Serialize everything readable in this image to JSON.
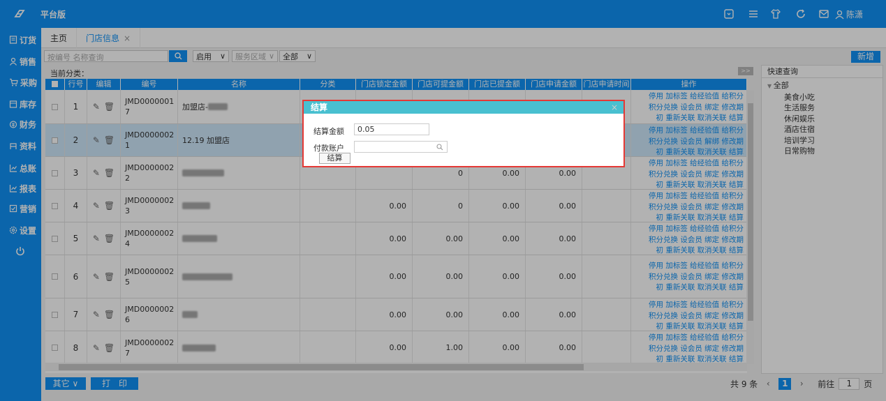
{
  "header": {
    "brand": "平台版",
    "user_name": "陈潇",
    "icons": [
      "fullscreen-icon",
      "menu-icon",
      "shirt-icon",
      "refresh-icon",
      "mail-icon",
      "user-icon"
    ]
  },
  "sidebar": {
    "items": [
      {
        "label": "订货",
        "icon": "order-icon"
      },
      {
        "label": "销售",
        "icon": "sales-icon"
      },
      {
        "label": "采购",
        "icon": "cart-icon"
      },
      {
        "label": "库存",
        "icon": "inventory-icon"
      },
      {
        "label": "财务",
        "icon": "finance-icon"
      },
      {
        "label": "资料",
        "icon": "data-icon"
      },
      {
        "label": "总账",
        "icon": "ledger-icon"
      },
      {
        "label": "报表",
        "icon": "report-icon"
      },
      {
        "label": "营销",
        "icon": "marketing-icon"
      },
      {
        "label": "设置",
        "icon": "settings-icon"
      }
    ]
  },
  "tabs": {
    "home": "主页",
    "store": "门店信息",
    "close": "×"
  },
  "toolbar": {
    "search_placeholder": "按编号 名称查询",
    "status_select": "启用",
    "region_select": "服务区域",
    "all_select": "全部",
    "new_label": "新增",
    "category_label": "当前分类：",
    "expand_label": ">>"
  },
  "table": {
    "columns": [
      "行号",
      "编辑",
      "编号",
      "名称",
      "分类",
      "门店锁定金额",
      "门店可提金额",
      "门店已提金额",
      "门店申请金额",
      "门店申请时间",
      "操作"
    ],
    "rows": [
      {
        "no": "1",
        "code": "JMD00000017",
        "name": "加盟店-",
        "locked": "",
        "avail": "",
        "withdrawn": "",
        "applied": ""
      },
      {
        "no": "2",
        "code": "JMD00000021",
        "name": "12.19 加盟店",
        "locked": "",
        "avail": "",
        "withdrawn": "",
        "applied": ""
      },
      {
        "no": "3",
        "code": "JMD00000022",
        "name": "",
        "locked": "",
        "avail": "0",
        "withdrawn": "0.00",
        "applied": "0.00"
      },
      {
        "no": "4",
        "code": "JMD00000023",
        "name": "",
        "locked": "0.00",
        "avail": "0",
        "withdrawn": "0.00",
        "applied": "0.00"
      },
      {
        "no": "5",
        "code": "JMD00000024",
        "name": "",
        "locked": "0.00",
        "avail": "0.00",
        "withdrawn": "0.00",
        "applied": "0.00"
      },
      {
        "no": "6",
        "code": "JMD00000025",
        "name": "",
        "locked": "0.00",
        "avail": "0.00",
        "withdrawn": "0.00",
        "applied": "0.00"
      },
      {
        "no": "7",
        "code": "JMD00000026",
        "name": "",
        "locked": "0.00",
        "avail": "0.00",
        "withdrawn": "0.00",
        "applied": "0.00"
      },
      {
        "no": "8",
        "code": "JMD00000027",
        "name": "",
        "locked": "0.00",
        "avail": "1.00",
        "withdrawn": "0.00",
        "applied": "0.00"
      }
    ],
    "ops_line1": "停用 加标签 给经验值 给积分",
    "ops_line2": "积分兑换 设会员 绑定 修改期",
    "ops_line2_alt": "积分兑换 设会员 解绑 修改期",
    "ops_line3": "初 重新关联 取消关联 结算"
  },
  "quick": {
    "title": "快速查询",
    "root": "全部",
    "items": [
      "美食小吃",
      "生活服务",
      "休闲娱乐",
      "酒店住宿",
      "培训学习",
      "日常购物"
    ]
  },
  "bottom": {
    "other": "其它",
    "print": "打　印",
    "total": "共 9 条",
    "page": "1",
    "goto": "前往",
    "goto_value": "1",
    "page_unit": "页"
  },
  "dialog": {
    "title": "结算",
    "amount_label": "结算金额",
    "amount_value": "0.05",
    "account_label": "付款账户",
    "settle_button": "结算"
  },
  "colors": {
    "primary": "#1191f5",
    "dialog_header": "#49c0d0",
    "highlight_border": "#e53935"
  }
}
